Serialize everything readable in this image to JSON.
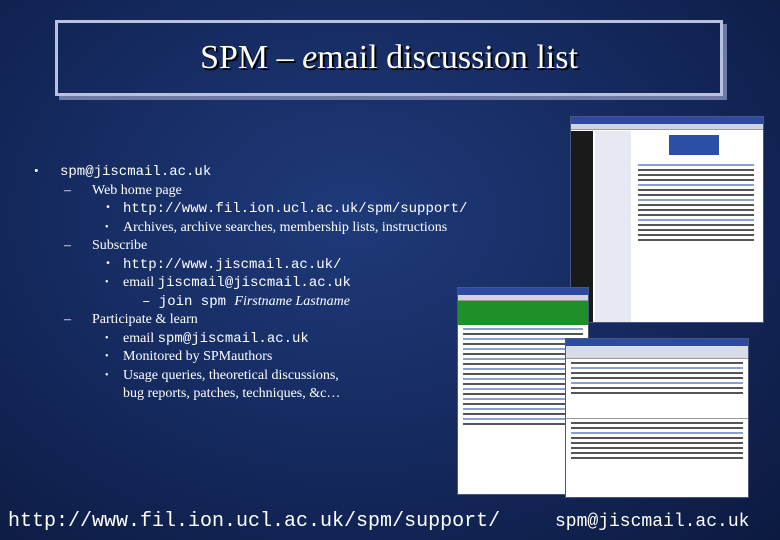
{
  "title": {
    "prefix": "SPM – ",
    "em": "e",
    "rest": "mail discussion list"
  },
  "content": {
    "list_address": "spm@jiscmail.ac.uk",
    "dash": "–",
    "web_home": "Web home page",
    "url_support": "http://www.fil.ion.ucl.ac.uk/spm/support/",
    "archives": "Archives, archive searches, membership lists, instructions",
    "subscribe": "Subscribe",
    "url_jiscmail": "http://www.jiscmail.ac.uk/",
    "email_label": "email ",
    "jiscmail_address": "jiscmail@jiscmail.ac.uk",
    "join_cmd": "– join spm ",
    "join_names": "Firstname Lastname",
    "participate": "Participate & learn",
    "email_label2": "email ",
    "list_address2": "spm@jiscmail.ac.uk",
    "monitored": "Monitored by SPMauthors",
    "usage1": "Usage queries, theoretical discussions,",
    "usage2": "bug reports, patches, techniques, &c…"
  },
  "footer": {
    "url": "http://www.fil.ion.ucl.ac.uk/spm/support/",
    "email": "spm@jiscmail.ac.uk"
  }
}
